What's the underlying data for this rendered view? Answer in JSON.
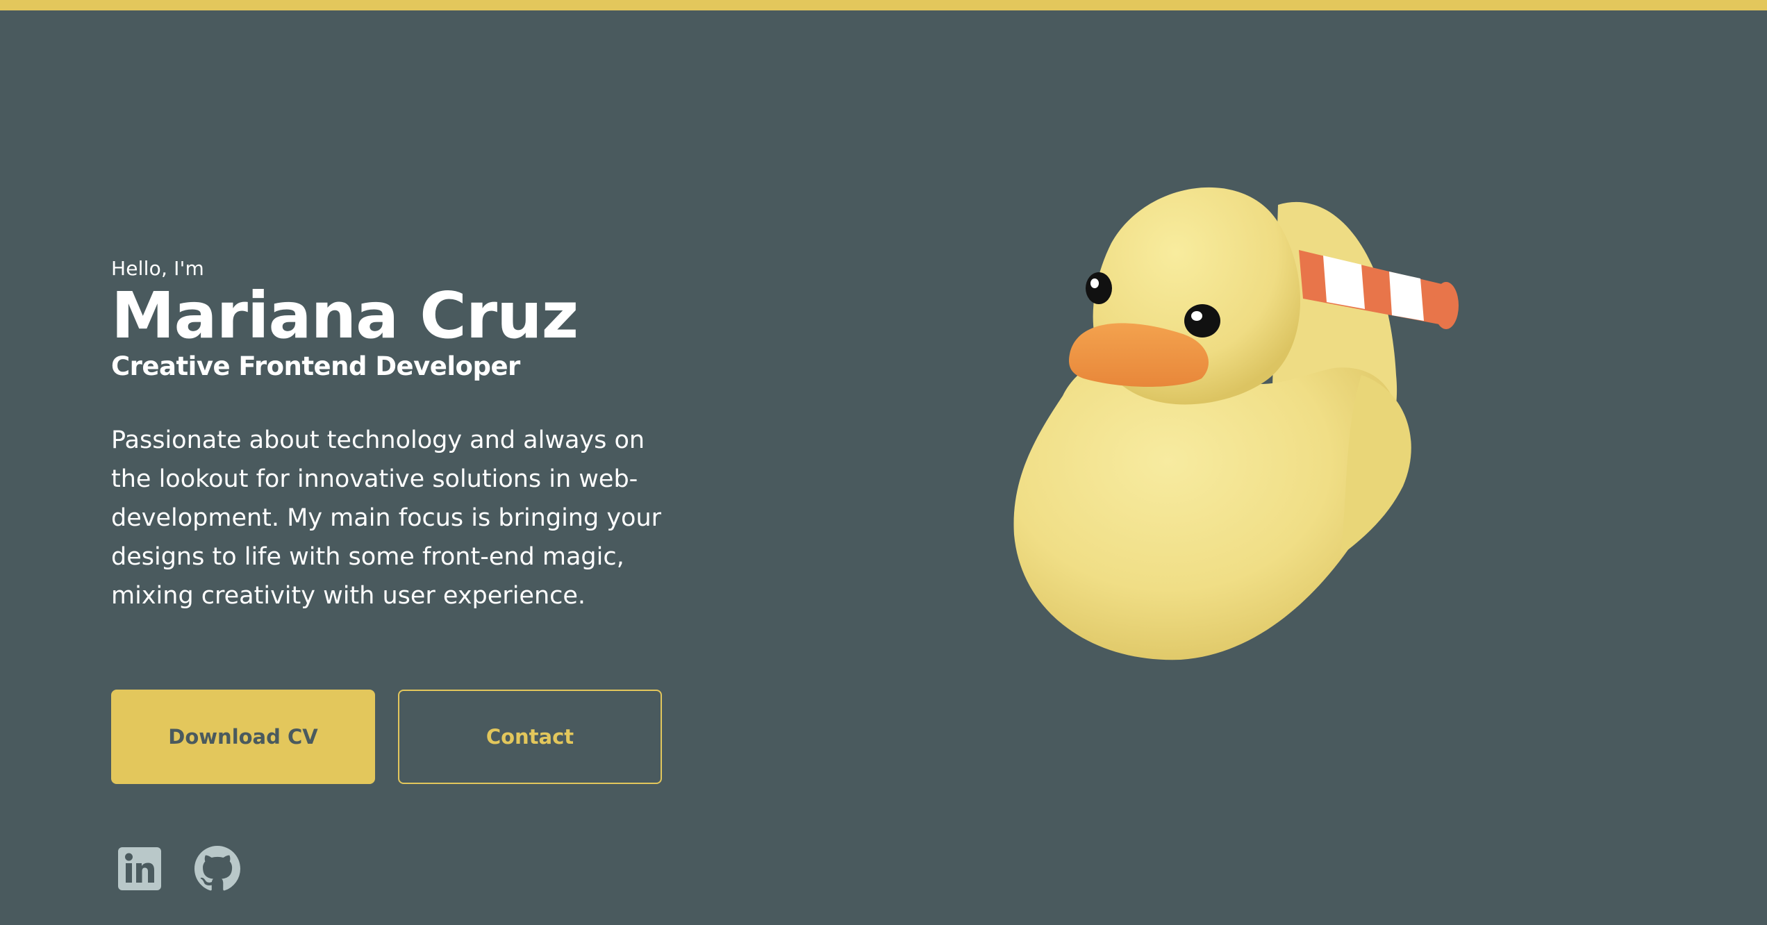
{
  "hero": {
    "greeting": "Hello, I'm",
    "name": "Mariana Cruz",
    "role": "Creative Frontend Developer",
    "bio": "Passionate about technology and always on the lookout for innovative solutions in web-development. My main focus is bringing your designs to life with some front-end magic, mixing creativity with user experience."
  },
  "buttons": {
    "download_cv": "Download CV",
    "contact": "Contact"
  },
  "socials": [
    {
      "icon": "linkedin-icon"
    },
    {
      "icon": "github-icon"
    }
  ],
  "illustration": {
    "icon": "rubber-duck-icon"
  },
  "colors": {
    "background": "#4a5a5e",
    "accent": "#e3c75c",
    "text": "#ffffff"
  }
}
